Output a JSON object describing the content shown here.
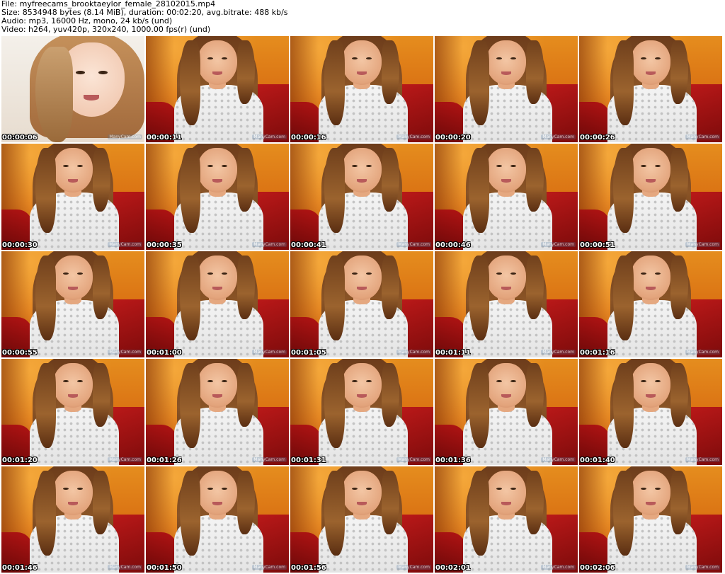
{
  "header": {
    "file_line": "File: myfreecams_brooktaeylor_female_28102015.mp4",
    "size_line": "Size: 8534948 bytes (8.14 MiB), duration: 00:02:20, avg.bitrate: 488 kb/s",
    "audio_line": "Audio: mp3, 16000 Hz, mono, 24 kb/s (und)",
    "video_line": "Video: h264, yuv420p, 320x240, 1000.00 fps(r) (und)"
  },
  "watermark_text": "ManyCam.com",
  "frames": [
    {
      "timestamp": "00:00:06"
    },
    {
      "timestamp": "00:00:11"
    },
    {
      "timestamp": "00:00:16"
    },
    {
      "timestamp": "00:00:20"
    },
    {
      "timestamp": "00:00:26"
    },
    {
      "timestamp": "00:00:30"
    },
    {
      "timestamp": "00:00:35"
    },
    {
      "timestamp": "00:00:41"
    },
    {
      "timestamp": "00:00:46"
    },
    {
      "timestamp": "00:00:51"
    },
    {
      "timestamp": "00:00:55"
    },
    {
      "timestamp": "00:01:00"
    },
    {
      "timestamp": "00:01:05"
    },
    {
      "timestamp": "00:01:11"
    },
    {
      "timestamp": "00:01:16"
    },
    {
      "timestamp": "00:01:20"
    },
    {
      "timestamp": "00:01:26"
    },
    {
      "timestamp": "00:01:31"
    },
    {
      "timestamp": "00:01:36"
    },
    {
      "timestamp": "00:01:40"
    },
    {
      "timestamp": "00:01:46"
    },
    {
      "timestamp": "00:01:50"
    },
    {
      "timestamp": "00:01:56"
    },
    {
      "timestamp": "00:02:01"
    },
    {
      "timestamp": "00:02:06"
    }
  ]
}
